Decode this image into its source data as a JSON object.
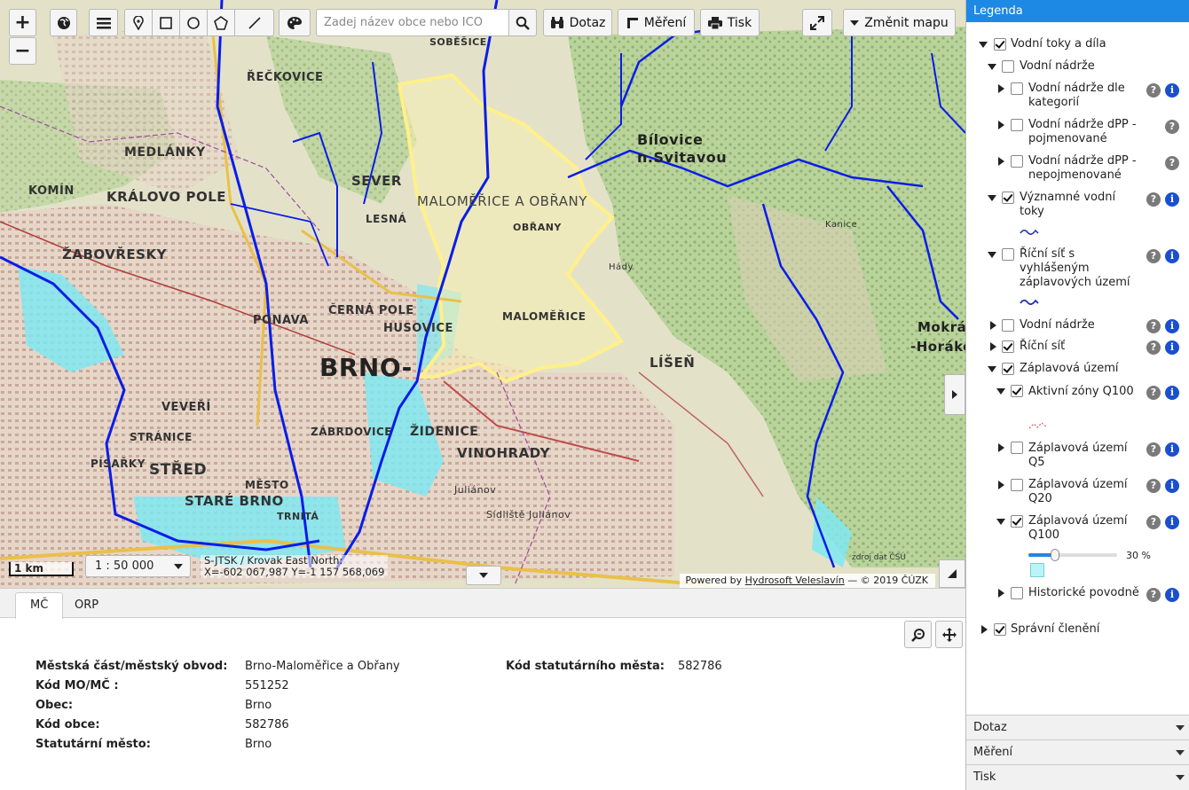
{
  "toolbar": {
    "zoom_in": "+",
    "zoom_out": "−",
    "search_placeholder": "Zadej název obce nebo IČO",
    "query_label": "Dotaz",
    "measure_label": "Měření",
    "print_label": "Tisk",
    "change_map_label": "Změnit mapu"
  },
  "map": {
    "scale_bar_label": "1 km",
    "scale_value": "1 : 50 000",
    "coord_system": "S-JTSK / Krovak East North:",
    "coord_readout": "X=-602 067,987 Y=-1 157 568,069",
    "attribution_prefix": "Powered by",
    "attribution_link": "Hydrosoft Veleslavín",
    "attribution_suffix": " — © 2019 ČÚZK",
    "source_note": "zdroj dat ČSÚ",
    "labels": {
      "brno": "BRNO-",
      "malomerice_obrany": "MALOMĚŘICE A OBŘANY",
      "malomerice": "MALOMĚŘICE",
      "obrany": "OBŘANY",
      "bilovice": "Bílovice",
      "n_svitavou": "n.Svitavou",
      "medlanky": "MEDLÁNKY",
      "kralovo_pole": "KRÁLOVO POLE",
      "zabovresky": "ŽABOVŘESKY",
      "recovice": "ŘEČKOVICE",
      "sever": "SEVER",
      "lesna": "LESNÁ",
      "cerna_pole": "ČERNÁ POLE",
      "husovice": "HUSOVICE",
      "ponava": "PONAVA",
      "zidenice": "ŽIDENICE",
      "vinohrady": "VINOHRADY",
      "zabrdovice": "ZÁBRDOVICE",
      "veveri": "VEVEŘÍ",
      "stranice": "STRÁNICE",
      "pisarky": "PÍSAŘKY",
      "stred": "STŘED",
      "stare_brno": "STARÉ BRNO",
      "mesto": "MĚSTO",
      "trnita": "TRNITÁ",
      "lisen": "LÍŠEŇ",
      "mokra": "Mokrá-",
      "horakov": "-Horákov",
      "komin": "KOMÍN",
      "sobesice": "SOBĚŠICE",
      "hady": "Hády",
      "juliánov": "Juliánov",
      "sidliste_julianov": "Sídliště Juliánov",
      "kanice": "Kanice"
    }
  },
  "bottom_panel": {
    "tabs": [
      "MČ",
      "ORP"
    ],
    "active_tab": "MČ",
    "fields": [
      {
        "label": "Městská část/městský obvod:",
        "value": "Brno-Maloměřice a Obřany"
      },
      {
        "label": "Kód MO/MČ :",
        "value": "551252"
      },
      {
        "label": "Obec:",
        "value": "Brno"
      },
      {
        "label": "Kód obce:",
        "value": "582786"
      },
      {
        "label": "Statutární město:",
        "value": "Brno"
      }
    ],
    "right_field": {
      "label": "Kód statutárního města:",
      "value": "582786"
    }
  },
  "legend": {
    "title": "Legenda",
    "items": [
      {
        "label": "Vodní toky a díla"
      },
      {
        "label": "Vodní nádrže"
      },
      {
        "label": "Vodní nádrže dle kategorií"
      },
      {
        "label": "Vodní nádrže dPP - pojmenované"
      },
      {
        "label": "Vodní nádrže dPP - nepojmenované"
      },
      {
        "label": "Významné vodní toky"
      },
      {
        "label": "Říční síť s vyhlášeným záplavových území"
      },
      {
        "label": "Vodní nádrže"
      },
      {
        "label": "Říční síť"
      },
      {
        "label": "Záplavová území"
      },
      {
        "label": "Aktivní zóny Q100"
      },
      {
        "label": "Záplavová území Q5"
      },
      {
        "label": "Záplavová území Q20"
      },
      {
        "label": "Záplavová území Q100"
      },
      {
        "label": "Historické povodně"
      },
      {
        "label": "Správní členění"
      }
    ],
    "opacity_label": "30 %",
    "opacity_value": 0.3,
    "accordion": [
      "Dotaz",
      "Měření",
      "Tisk"
    ]
  },
  "colors": {
    "accent": "#1e88e5",
    "river": "#0a1de8",
    "flood_zone": "#7fe7f0",
    "selection": "#fff08a"
  }
}
